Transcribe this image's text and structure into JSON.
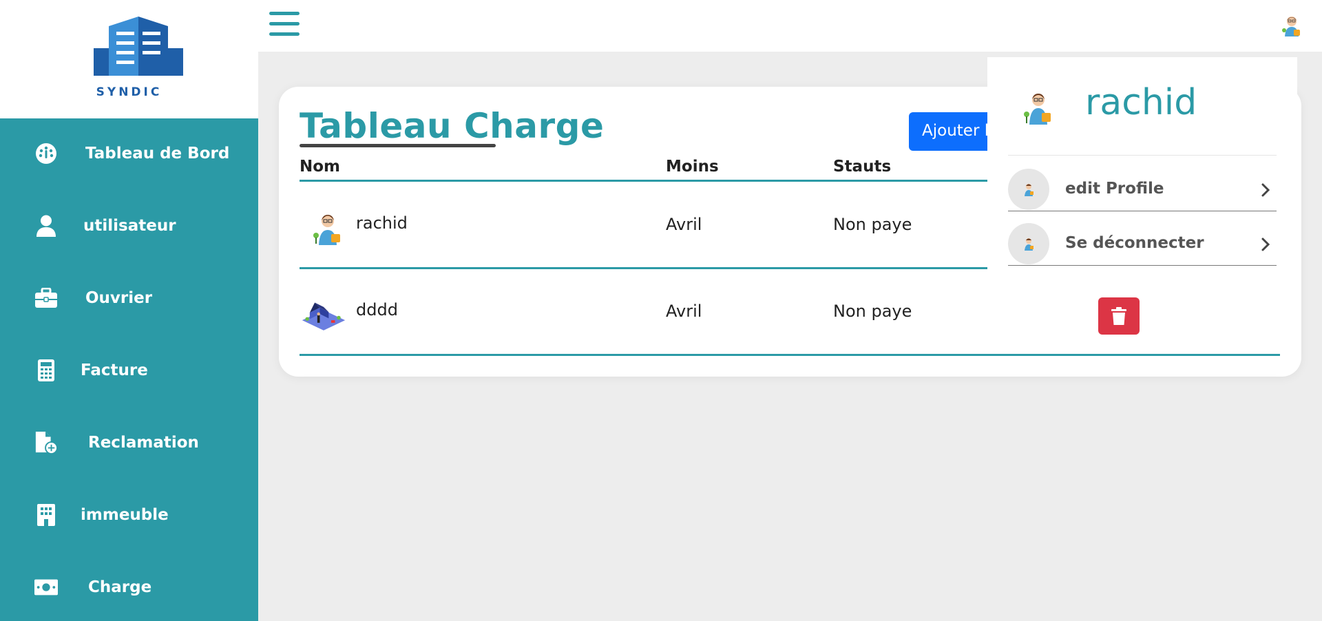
{
  "logo": {
    "text": "SYNDIC"
  },
  "sidebar": {
    "items": [
      {
        "label": "Tableau de Bord",
        "icon": "dashboard-icon"
      },
      {
        "label": "utilisateur",
        "icon": "user-icon"
      },
      {
        "label": "Ouvrier",
        "icon": "briefcase-icon"
      },
      {
        "label": "Facture",
        "icon": "calculator-icon"
      },
      {
        "label": "Reclamation",
        "icon": "file-plus-icon"
      },
      {
        "label": "immeuble",
        "icon": "building-icon"
      },
      {
        "label": "Charge",
        "icon": "money-bill-icon"
      }
    ]
  },
  "topbar": {
    "menu_icon": "hamburger-icon",
    "avatar_icon": "user-avatar-icon"
  },
  "main": {
    "title": "Tableau Charge",
    "add_button_label": "Ajouter l",
    "table": {
      "headers": [
        "Nom",
        "Moins",
        "Stauts"
      ],
      "rows": [
        {
          "name": "rachid",
          "month": "Avril",
          "status": "Non paye",
          "avatar": "person-avatar"
        },
        {
          "name": "dddd",
          "month": "Avril",
          "status": "Non paye",
          "avatar": "house-avatar"
        }
      ]
    }
  },
  "dropdown": {
    "user_name": "rachid",
    "items": [
      {
        "label": "edit Profile"
      },
      {
        "label": "Se déconnecter"
      }
    ]
  },
  "colors": {
    "primary": "#2b9aa6",
    "add_button": "#0d6efd",
    "delete_button": "#dc3545",
    "background": "#ededed"
  }
}
